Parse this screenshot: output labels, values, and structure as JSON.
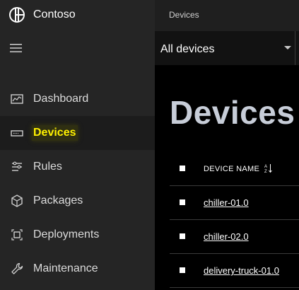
{
  "app": {
    "name": "Contoso"
  },
  "header": {
    "breadcrumb": "Devices"
  },
  "sidebar": {
    "items": [
      {
        "label": "Dashboard",
        "icon": "dashboard-icon",
        "active": false
      },
      {
        "label": "Devices",
        "icon": "device-icon",
        "active": true
      },
      {
        "label": "Rules",
        "icon": "rules-icon",
        "active": false
      },
      {
        "label": "Packages",
        "icon": "package-icon",
        "active": false
      },
      {
        "label": "Deployments",
        "icon": "deployments-icon",
        "active": false
      },
      {
        "label": "Maintenance",
        "icon": "maintenance-icon",
        "active": false
      }
    ]
  },
  "filter": {
    "selected": "All devices"
  },
  "main": {
    "title": "Devices"
  },
  "table": {
    "columns": [
      {
        "label": "DEVICE NAME",
        "sort_icon": "sort-icon"
      }
    ],
    "rows": [
      {
        "device_name": "chiller-01.0"
      },
      {
        "device_name": "chiller-02.0"
      },
      {
        "device_name": "delivery-truck-01.0"
      }
    ]
  },
  "colors": {
    "sidebar_bg": "#252525",
    "active_label": "#fff100",
    "title": "#c7cdd8",
    "main_bg": "#000000"
  }
}
